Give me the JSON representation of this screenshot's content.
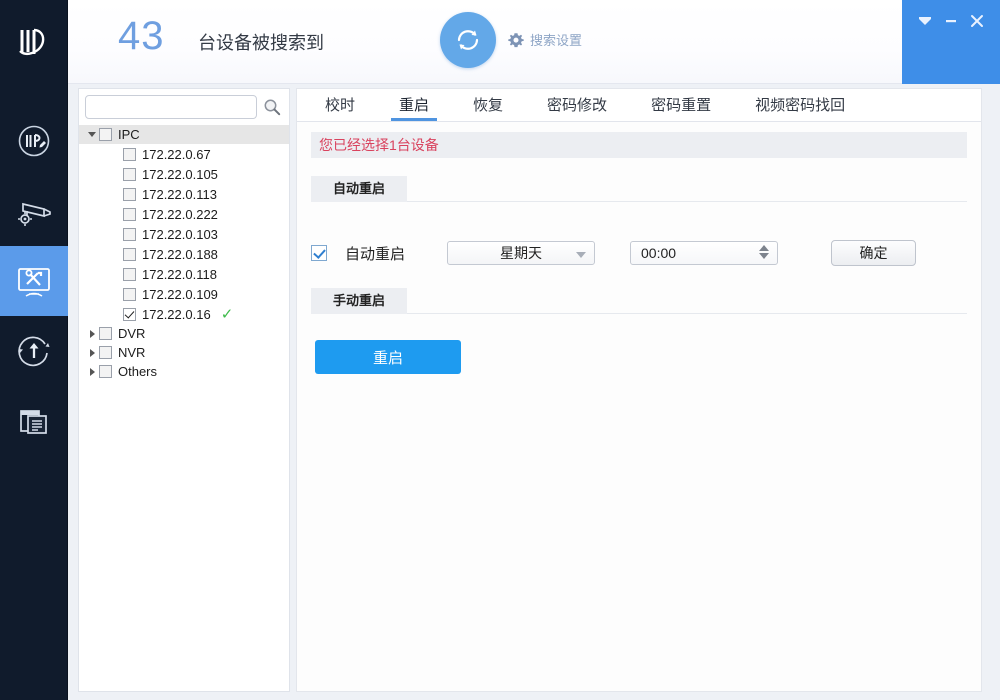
{
  "header": {
    "logo_icon": "id-monogram-logo",
    "device_count": "43",
    "count_suffix": "台设备被搜索到",
    "refresh_icon": "refresh-icon",
    "settings_icon": "gear-icon",
    "settings_label": "搜索设置",
    "accent_blue": "#3e8ee8",
    "count_color": "#6f9fe0",
    "window_controls": [
      {
        "name": "restore-down-button",
        "glyph": "▼"
      },
      {
        "name": "minimize-button",
        "glyph": "—"
      },
      {
        "name": "close-button",
        "glyph": "✕"
      }
    ]
  },
  "rail": {
    "items": [
      {
        "name": "sidebar-item-ip-config",
        "icon": "ip-edit-icon",
        "active": false
      },
      {
        "name": "sidebar-item-camera-config",
        "icon": "camera-gear-icon",
        "active": false
      },
      {
        "name": "sidebar-item-device-tools",
        "icon": "tools-monitor-icon",
        "active": true
      },
      {
        "name": "sidebar-item-upgrade",
        "icon": "upload-arrow-icon",
        "active": false
      },
      {
        "name": "sidebar-item-logs",
        "icon": "documents-icon",
        "active": false
      }
    ],
    "active_bg": "#5b9bea"
  },
  "tree": {
    "search_placeholder": "",
    "search_value": "",
    "search_icon": "search-icon",
    "groups": [
      {
        "label": "IPC",
        "expanded": true,
        "checked": false,
        "selected": true,
        "children": [
          {
            "label": "172.22.0.67",
            "checked": false,
            "ok": false
          },
          {
            "label": "172.22.0.105",
            "checked": false,
            "ok": false
          },
          {
            "label": "172.22.0.113",
            "checked": false,
            "ok": false
          },
          {
            "label": "172.22.0.222",
            "checked": false,
            "ok": false
          },
          {
            "label": "172.22.0.103",
            "checked": false,
            "ok": false
          },
          {
            "label": "172.22.0.188",
            "checked": false,
            "ok": false
          },
          {
            "label": "172.22.0.118",
            "checked": false,
            "ok": false
          },
          {
            "label": "172.22.0.109",
            "checked": false,
            "ok": false
          },
          {
            "label": "172.22.0.16",
            "checked": true,
            "ok": true
          }
        ]
      },
      {
        "label": "DVR",
        "expanded": false,
        "checked": false,
        "selected": false,
        "children": []
      },
      {
        "label": "NVR",
        "expanded": false,
        "checked": false,
        "selected": false,
        "children": []
      },
      {
        "label": "Others",
        "expanded": false,
        "checked": false,
        "selected": false,
        "children": []
      }
    ],
    "ok_mark": "✓",
    "ok_color": "#3ebb4b"
  },
  "main": {
    "tabs": [
      {
        "label": "校时",
        "active": false
      },
      {
        "label": "重启",
        "active": true
      },
      {
        "label": "恢复",
        "active": false
      },
      {
        "label": "密码修改",
        "active": false
      },
      {
        "label": "密码重置",
        "active": false
      },
      {
        "label": "视频密码找回",
        "active": false
      }
    ],
    "notice": "您已经选择1台设备",
    "notice_color": "#d9435e",
    "auto_section": {
      "title": "自动重启",
      "checkbox_checked": true,
      "checkbox_label": "自动重启",
      "day_value": "星期天",
      "time_value": "00:00",
      "confirm_label": "确定"
    },
    "manual_section": {
      "title": "手动重启",
      "restart_label": "重启",
      "restart_color": "#1e9bf0"
    }
  }
}
